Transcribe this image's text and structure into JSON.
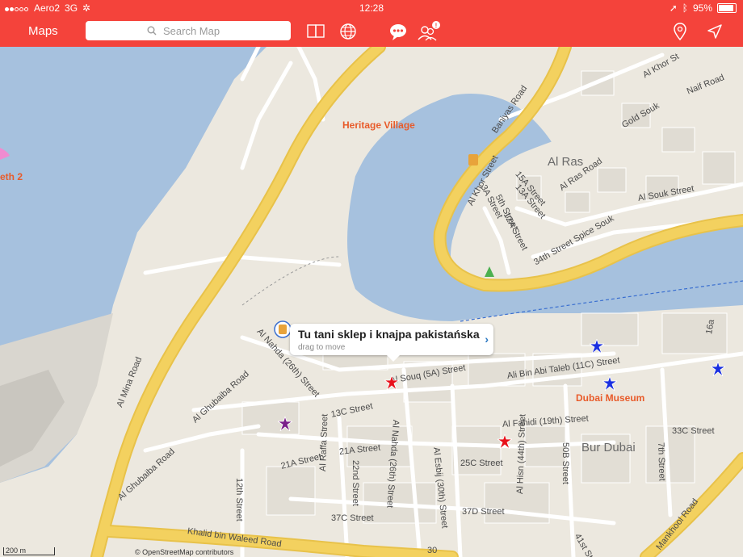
{
  "status": {
    "carrier": "Aero2",
    "network": "3G",
    "time": "12:28",
    "battery": "95%"
  },
  "toolbar": {
    "maps_label": "Maps",
    "search_placeholder": "Search Map"
  },
  "map": {
    "places": {
      "heritage": "Heritage Village",
      "al_ras": "Al Ras",
      "bur_dubai": "Bur Dubai",
      "museum": "Dubai Museum",
      "berth": "eth 2"
    },
    "streets": {
      "baniyas": "Baniyas Road",
      "al_khor_top": "Al Khor St",
      "naif": "Naif Road",
      "gold_souk": "Gold Souk",
      "al_khor_street": "Al Khor Street",
      "s15a": "15A Street",
      "s13a": "13A Street",
      "s3a": "3A Street",
      "s5th": "5th Street",
      "s12a": "12A Street",
      "al_ras_road": "Al Ras Road",
      "al_souk": "Al Souk Street",
      "spice_souk": "34th Street Spice Souk",
      "al_mina": "Al Mina Road",
      "al_nahda": "Al Nahda (26th) Street",
      "souq": "Al Souq (5A) Street",
      "ali_bin": "Ali Bin Abi Taleb (11C) Street",
      "ghubaiba": "Al Ghubaiba Road",
      "ghubaiba2": "Al Ghubaiba Road",
      "s13c": "13C Street",
      "s21a": "21A Street",
      "s21a2": "21A Street",
      "al_fahidi": "Al Fahidi (19th) Street",
      "s33c": "33C Street",
      "s7th": "7th Street",
      "s50b": "50B Street",
      "s25c": "25C Street",
      "al_esbij": "Al Esbij (30th) Street",
      "al_nahda2": "Al Nahda (26th) Street",
      "s22nd": "22nd Street",
      "al_raffa": "Al Raffa Street",
      "s12th": "12th Street",
      "s37c": "37C Street",
      "s37d": "37D Street",
      "al_hisn": "Al Hisn (44th) Street",
      "s41st": "41st Street",
      "mankhool": "Mankhool Road",
      "khalid": "Khalid bin Waleed Road",
      "s16a": "16a",
      "s30": "30"
    }
  },
  "callout": {
    "title": "Tu tani sklep i knajpa pakistańska",
    "subtitle": "drag to move"
  },
  "footer": {
    "scale": "200 m",
    "attribution": "© OpenStreetMap contributors"
  },
  "colors": {
    "accent": "#f4433b",
    "water": "#a6c1de",
    "highway": "#f3d15f",
    "land": "#ece8df",
    "marker_red": "#e8101a",
    "marker_blue": "#1a2fe0",
    "marker_purple": "#7a1f8a"
  }
}
